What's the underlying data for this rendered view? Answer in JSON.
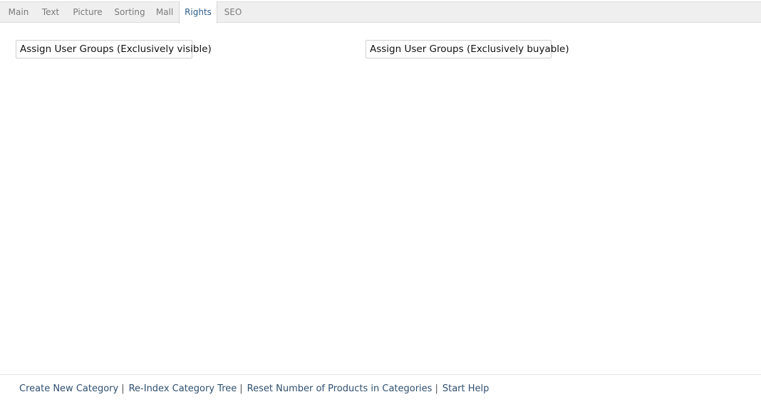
{
  "tabs": [
    {
      "label": "Main"
    },
    {
      "label": "Text"
    },
    {
      "label": "Picture"
    },
    {
      "label": "Sorting"
    },
    {
      "label": "Mall"
    },
    {
      "label": "Rights",
      "active": true
    },
    {
      "label": "SEO"
    }
  ],
  "rights": {
    "visible_button_label": "Assign User Groups (Exclusively visible)",
    "buyable_button_label": "Assign User Groups (Exclusively buyable)"
  },
  "footer": {
    "links": [
      {
        "label": "Create New Category"
      },
      {
        "label": "Re-Index Category Tree"
      },
      {
        "label": "Reset Number of Products in Categories"
      },
      {
        "label": "Start Help"
      }
    ],
    "separator": "|"
  },
  "colors": {
    "tabbar_bg": "#efefef",
    "active_tab_text": "#2f5f8f",
    "footer_link": "#2f4f6f"
  }
}
